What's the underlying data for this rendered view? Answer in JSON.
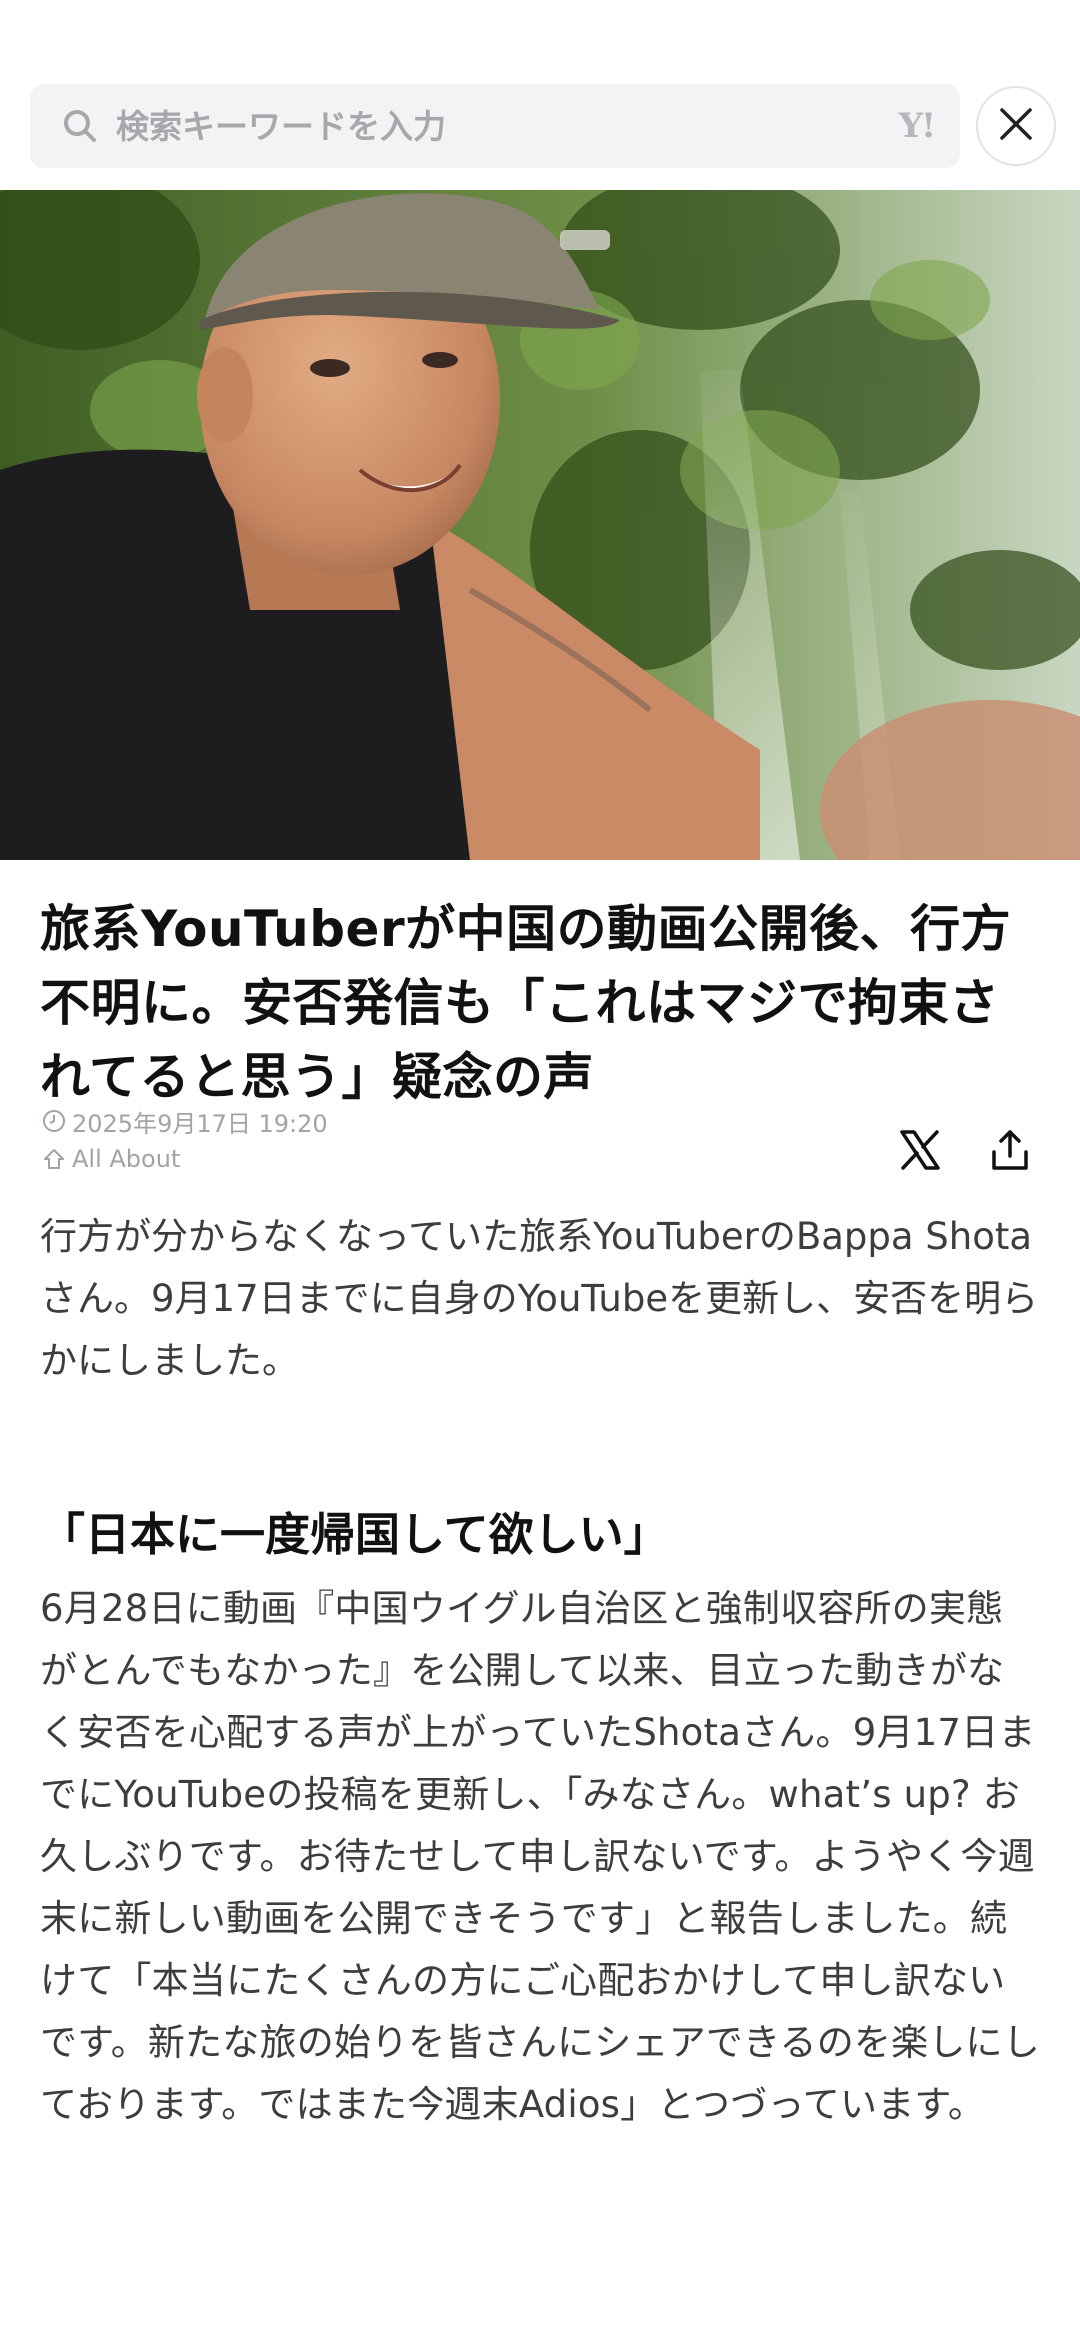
{
  "search": {
    "placeholder": "検索キーワードを入力",
    "logo_text": "Y!"
  },
  "icons": {
    "search": "search-icon",
    "close": "close-icon",
    "clock": "clock-icon",
    "source": "source-icon",
    "x_share": "x-logo-icon",
    "share": "share-icon"
  },
  "article": {
    "headline": "旅系YouTuberが中国の動画公開後、行方不明に。安否発信も「これはマジで拘束されてると思う」疑念の声",
    "date": "2025年9月17日 19:20",
    "source": "All About",
    "lead": "行方が分からなくなっていた旅系YouTuberのBappa Shotaさん。9月17日までに自身のYouTubeを更新し、安否を明らかにしました。",
    "section_heading": "「日本に一度帰国して欲しい」",
    "body": "6月28日に動画『中国ウイグル自治区と強制収容所の実態がとんでもなかった』を公開して以来、目立った動きがなく安否を心配する声が上がっていたShotaさん。9月17日までにYouTubeの投稿を更新し、「みなさん。what’s up? お久しぶりです。お待たせして申し訳ないです。ようやく今週末に新しい動画を公開できそうです」と報告しました。続けて「本当にたくさんの方にご心配おかけして申し訳ないです。新たな旅の始りを皆さんにシェアできるのを楽しにしております。ではまた今週末Adios」とつづっています。"
  },
  "colors": {
    "search_bg": "#f2f3f5",
    "placeholder": "#a6a8ac",
    "meta": "#a0a3a8",
    "headline": "#111111",
    "body": "#3d3d3d"
  }
}
